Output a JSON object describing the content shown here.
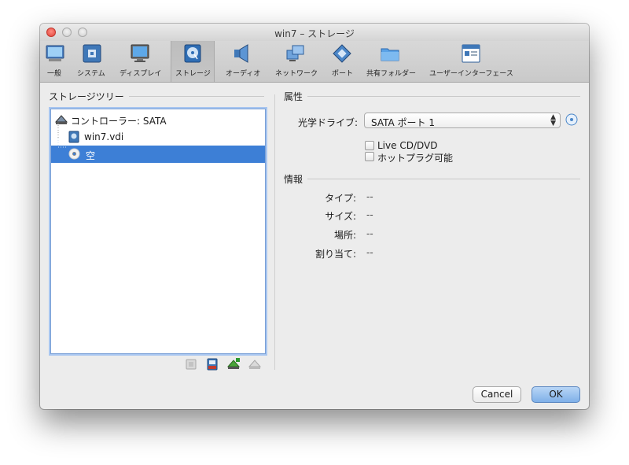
{
  "window": {
    "title": "win7 – ストレージ"
  },
  "toolbar": {
    "items": [
      {
        "label": "一般",
        "icon": "general-icon"
      },
      {
        "label": "システム",
        "icon": "system-icon"
      },
      {
        "label": "ディスプレイ",
        "icon": "display-icon"
      },
      {
        "label": "ストレージ",
        "icon": "storage-icon",
        "selected": true
      },
      {
        "label": "オーディオ",
        "icon": "audio-icon"
      },
      {
        "label": "ネットワーク",
        "icon": "network-icon"
      },
      {
        "label": "ポート",
        "icon": "port-icon"
      },
      {
        "label": "共有フォルダー",
        "icon": "shared-folder-icon"
      },
      {
        "label": "ユーザーインターフェース",
        "icon": "user-interface-icon"
      }
    ]
  },
  "storage_tree": {
    "header": "ストレージツリー",
    "controller": "コントローラー: SATA",
    "items": [
      {
        "label": "win7.vdi",
        "icon": "hard-disk-icon"
      },
      {
        "label": "空",
        "icon": "optical-disc-icon",
        "selected": true
      }
    ]
  },
  "attributes": {
    "header": "属性",
    "optical_drive_label": "光学ドライブ:",
    "optical_drive_value": "SATA ポート 1",
    "live_cd": "Live CD/DVD",
    "hotplug": "ホットプラグ可能"
  },
  "information": {
    "header": "情報",
    "rows": [
      {
        "label": "タイプ:",
        "value": "--"
      },
      {
        "label": "サイズ:",
        "value": "--"
      },
      {
        "label": "場所:",
        "value": "--"
      },
      {
        "label": "割り当て:",
        "value": "--"
      }
    ]
  },
  "buttons": {
    "cancel": "Cancel",
    "ok": "OK"
  },
  "colors": {
    "selection": "#3d7fd6",
    "ok_button": "#7fb0e8"
  }
}
